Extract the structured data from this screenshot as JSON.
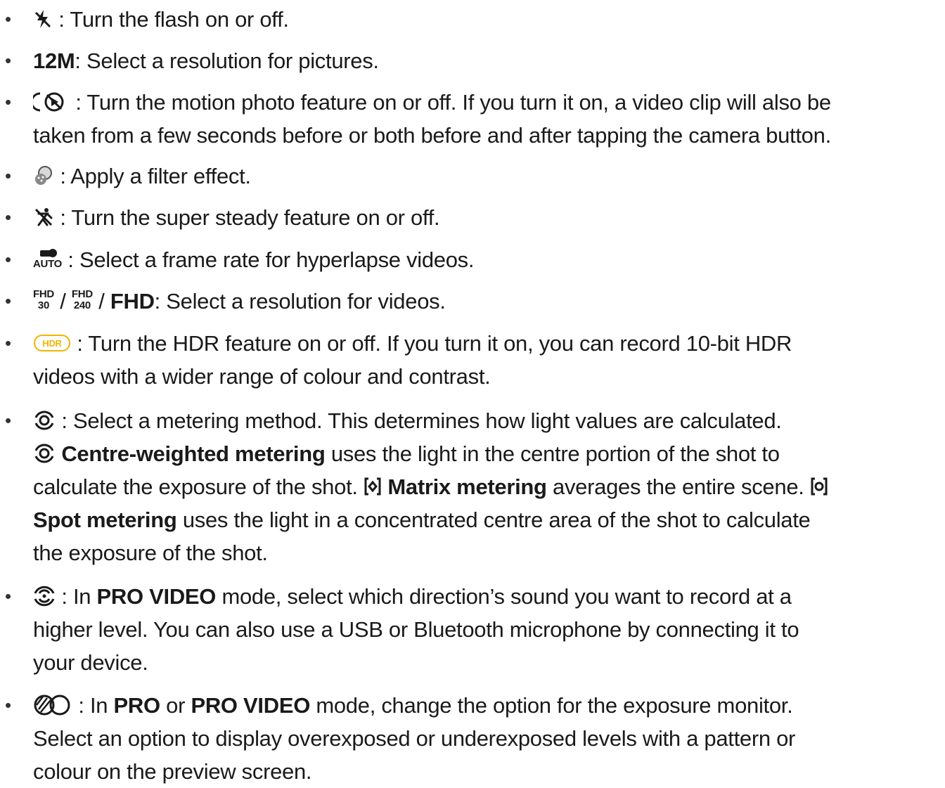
{
  "items": [
    {
      "lines": [
        ": Turn the flash on or off."
      ],
      "icon": "flash-icon"
    },
    {
      "bold": "12M",
      "lines": [
        ": Select a resolution for pictures."
      ]
    },
    {
      "icon": "motion-photo-icon",
      "lines": [
        ": Turn the motion photo feature on or off. If you turn it on, a video clip will also be",
        "taken from a few seconds before or both before and after tapping the camera button."
      ]
    },
    {
      "icon": "filter-icon",
      "lines": [
        ": Apply a filter effect."
      ]
    },
    {
      "icon": "super-steady-icon",
      "lines": [
        ": Turn the super steady feature on or off."
      ]
    },
    {
      "icon": "frame-rate-icon",
      "icon_label": "AUTO",
      "lines": [
        ": Select a frame rate for hyperlapse videos."
      ]
    },
    {
      "tag1_top": "FHD",
      "tag1_bottom": "30",
      "sep": "/",
      "tag2_top": "FHD",
      "tag2_bottom": "240",
      "bold": "FHD",
      "lines": [
        ": Select a resolution for videos."
      ]
    },
    {
      "icon": "hdr-icon",
      "icon_label": "HDR",
      "lines": [
        ": Turn the HDR feature on or off. If you turn it on, you can record 10-bit HDR",
        "videos with a wider range of colour and contrast."
      ]
    },
    {
      "icon": "metering-icon",
      "line1": ": Select a metering method. This determines how light values are calculated.",
      "centre_bold": "Centre-weighted metering",
      "centre_text": "uses the light in the centre portion of the shot to",
      "line3a": "calculate the exposure of the shot.",
      "matrix_bold": "Matrix metering",
      "matrix_text": "averages the entire scene.",
      "spot_bold": "Spot metering",
      "spot_text": "uses the light in a concentrated centre area of the shot to calculate",
      "line5": "the exposure of the shot."
    },
    {
      "icon": "audio-direction-icon",
      "pre": ": In",
      "bold": "PRO VIDEO",
      "post": "mode, select which direction’s sound you want to record at a",
      "line2": "higher level. You can also use a USB or Bluetooth microphone by connecting it to",
      "line3": "your device."
    },
    {
      "icon": "exposure-monitor-icon",
      "pre": ": In",
      "bold1": "PRO",
      "mid": "or",
      "bold2": "PRO VIDEO",
      "post": "mode, change the option for the exposure monitor.",
      "line2": "Select an option to display overexposed or underexposed levels with a pattern or",
      "line3": "colour on the preview screen."
    }
  ],
  "bullet": "•",
  "colors": {
    "text": "#1a1a1a",
    "hdr_accent": "#f0b400"
  }
}
